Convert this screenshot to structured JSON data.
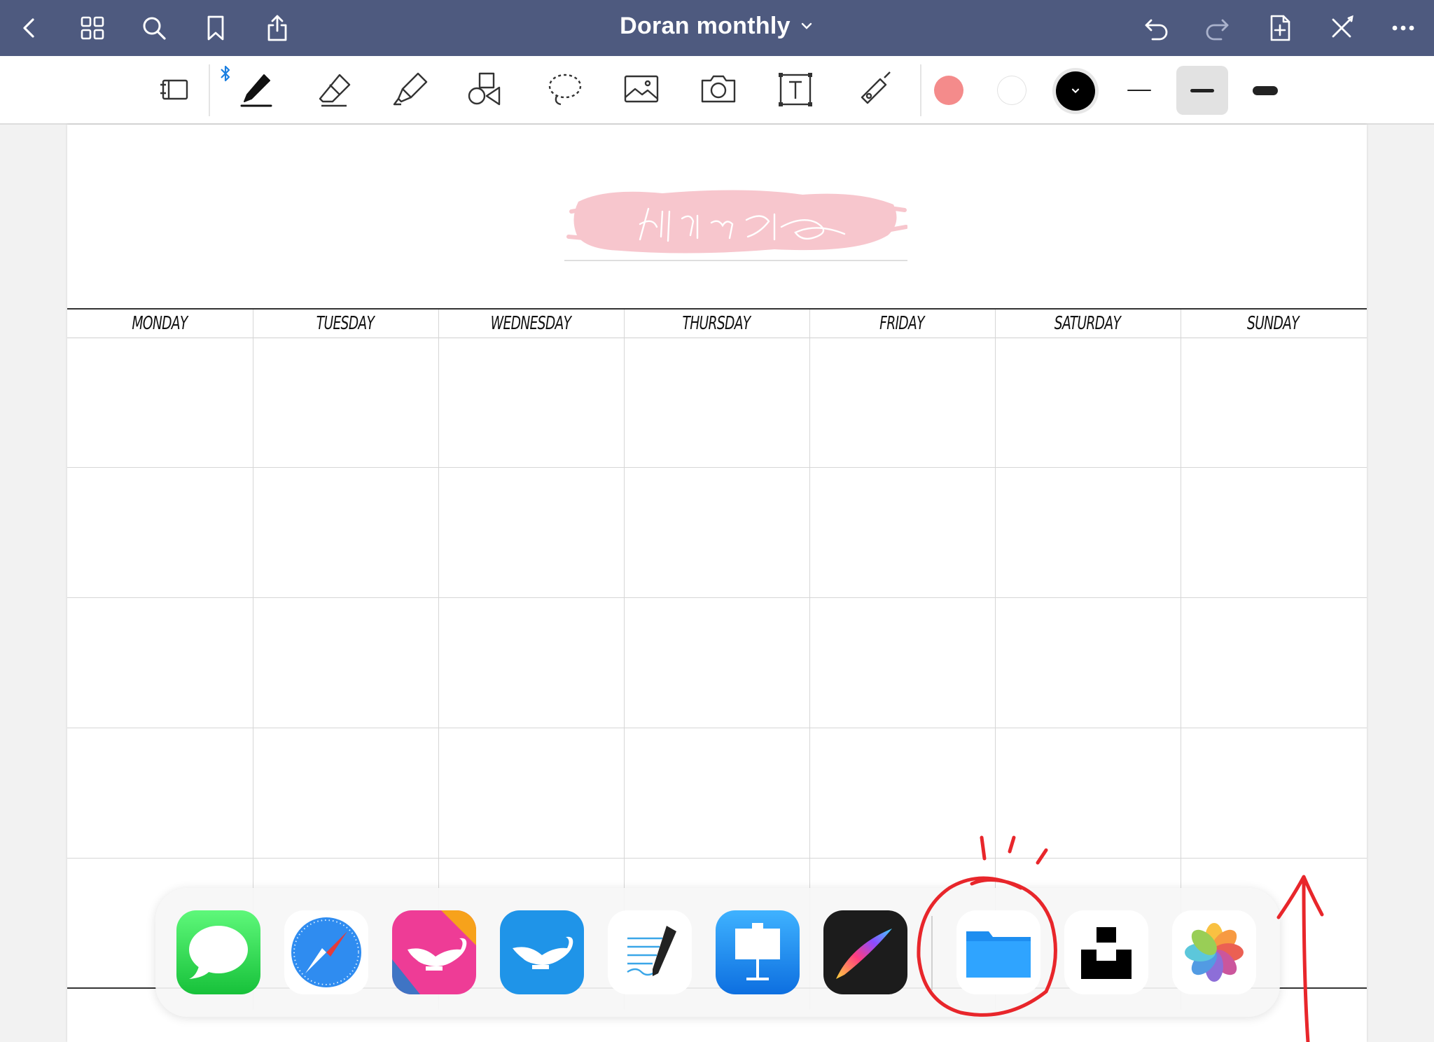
{
  "navbar": {
    "title": "Doran monthly",
    "icons": [
      "back-icon",
      "grid-icon",
      "search-icon",
      "bookmark-icon",
      "share-icon",
      "undo-icon",
      "redo-icon",
      "add-page-icon",
      "close-pen-icon",
      "more-icon"
    ]
  },
  "toolbar": {
    "tools": [
      "page-view-icon",
      "pen-icon",
      "eraser-icon",
      "highlighter-icon",
      "shapes-icon",
      "lasso-icon",
      "image-icon",
      "camera-icon",
      "text-box-icon",
      "laser-pointer-icon"
    ],
    "colors": [
      "#f48b8b",
      "#ffffff",
      "#000000"
    ],
    "selected_color": "#000000",
    "stroke_widths": [
      "thin",
      "medium",
      "thick"
    ],
    "selected_stroke": "medium",
    "bluetooth": true
  },
  "calendar": {
    "header_art": "pink-brush-lettering",
    "days": [
      "MONDAY",
      "TUESDAY",
      "WEDNESDAY",
      "THURSDAY",
      "FRIDAY",
      "SATURDAY",
      "SUNDAY"
    ]
  },
  "dock": {
    "apps": [
      "Messages",
      "Safari",
      "Aladdin app",
      "Aladdin lamp app",
      "Notes app",
      "Keynote",
      "Procreate",
      "Files",
      "Unsplash",
      "Photos"
    ]
  },
  "accent": "#4e5a7f",
  "annotation_color": "#e8262b"
}
